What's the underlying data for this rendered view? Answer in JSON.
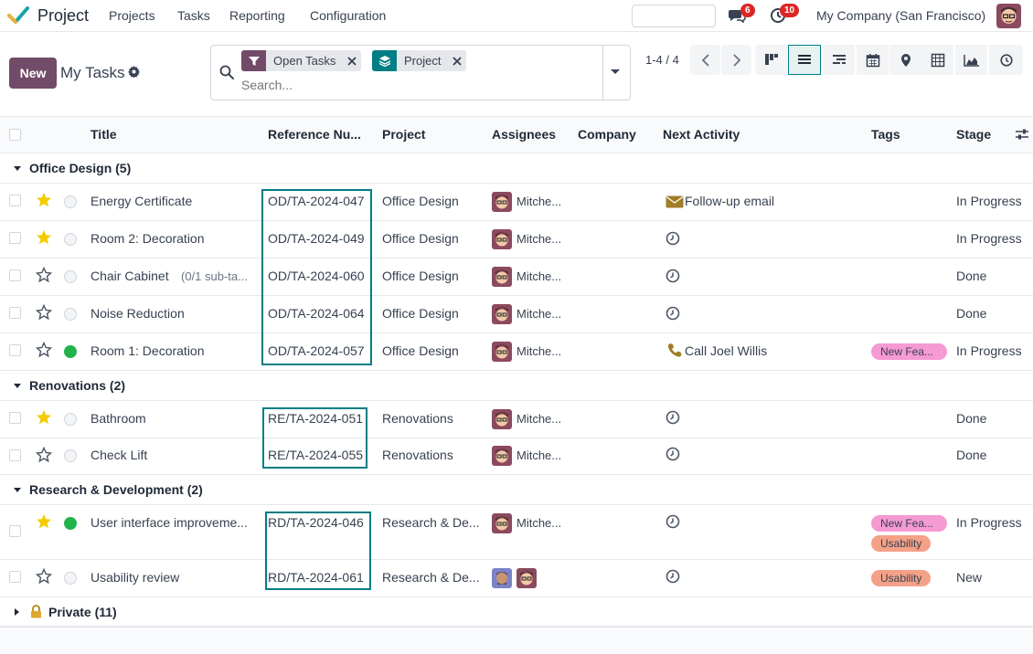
{
  "navbar": {
    "app_name": "Project",
    "menus": [
      "Projects",
      "Tasks",
      "Reporting",
      "Configuration"
    ],
    "messages_count": "6",
    "activities_count": "10",
    "company": "My Company (San Francisco)"
  },
  "control": {
    "new_label": "New",
    "title": "My Tasks",
    "facets": [
      "Open Tasks",
      "Project"
    ],
    "search_placeholder": "Search...",
    "pager": "1-4 / 4"
  },
  "columns": [
    "Title",
    "Reference Nu...",
    "Project",
    "Assignees",
    "Company",
    "Next Activity",
    "Tags",
    "Stage"
  ],
  "groups": [
    {
      "label": "Office Design (5)",
      "rows": [
        {
          "title": "Energy Certificate",
          "sub": "",
          "ref": "OD/TA-2024-047",
          "project": "Office Design",
          "assignee": "Mitche...",
          "activity": "Follow-up email",
          "activity_icon": "envelope-icon",
          "tags": [],
          "stage": "In Progress",
          "starred": true,
          "status": "grey"
        },
        {
          "title": "Room 2: Decoration",
          "sub": "",
          "ref": "OD/TA-2024-049",
          "project": "Office Design",
          "assignee": "Mitche...",
          "activity": "",
          "activity_icon": "clock-icon",
          "tags": [],
          "stage": "In Progress",
          "starred": true,
          "status": "grey"
        },
        {
          "title": "Chair Cabinet",
          "sub": "(0/1 sub-ta...",
          "ref": "OD/TA-2024-060",
          "project": "Office Design",
          "assignee": "Mitche...",
          "activity": "",
          "activity_icon": "clock-icon",
          "tags": [],
          "stage": "Done",
          "starred": false,
          "status": "grey"
        },
        {
          "title": "Noise Reduction",
          "sub": "",
          "ref": "OD/TA-2024-064",
          "project": "Office Design",
          "assignee": "Mitche...",
          "activity": "",
          "activity_icon": "clock-icon",
          "tags": [],
          "stage": "Done",
          "starred": false,
          "status": "grey"
        },
        {
          "title": "Room 1: Decoration",
          "sub": "",
          "ref": "OD/TA-2024-057",
          "project": "Office Design",
          "assignee": "Mitche...",
          "activity": "Call Joel Willis",
          "activity_icon": "phone-icon",
          "tags": [
            "New Fea..."
          ],
          "stage": "In Progress",
          "starred": false,
          "status": "green"
        }
      ]
    },
    {
      "label": "Renovations (2)",
      "rows": [
        {
          "title": "Bathroom",
          "sub": "",
          "ref": "RE/TA-2024-051",
          "project": "Renovations",
          "assignee": "Mitche...",
          "activity": "",
          "activity_icon": "clock-icon",
          "tags": [],
          "stage": "Done",
          "starred": true,
          "status": "grey"
        },
        {
          "title": "Check Lift",
          "sub": "",
          "ref": "RE/TA-2024-055",
          "project": "Renovations",
          "assignee": "Mitche...",
          "activity": "",
          "activity_icon": "clock-icon",
          "tags": [],
          "stage": "Done",
          "starred": false,
          "status": "grey"
        }
      ]
    },
    {
      "label": "Research & Development (2)",
      "rows": [
        {
          "title": "User interface improveme...",
          "sub": "",
          "ref": "RD/TA-2024-046",
          "project": "Research & De...",
          "assignee": "Mitche...",
          "activity": "",
          "activity_icon": "clock-icon",
          "tags": [
            "New Fea...",
            "Usability"
          ],
          "stage": "In Progress",
          "starred": true,
          "status": "green"
        },
        {
          "title": "Usability review",
          "sub": "",
          "ref": "RD/TA-2024-061",
          "project": "Research & De...",
          "assignee": "",
          "activity": "",
          "activity_icon": "clock-icon",
          "tags": [
            "Usability"
          ],
          "stage": "New",
          "starred": false,
          "status": "grey"
        }
      ]
    },
    {
      "label": "Private (11)",
      "rows": []
    }
  ],
  "colors": {
    "brand": "#714b67",
    "accent": "#017e84",
    "star": "#f3cc00",
    "badge": "#dc2626"
  }
}
